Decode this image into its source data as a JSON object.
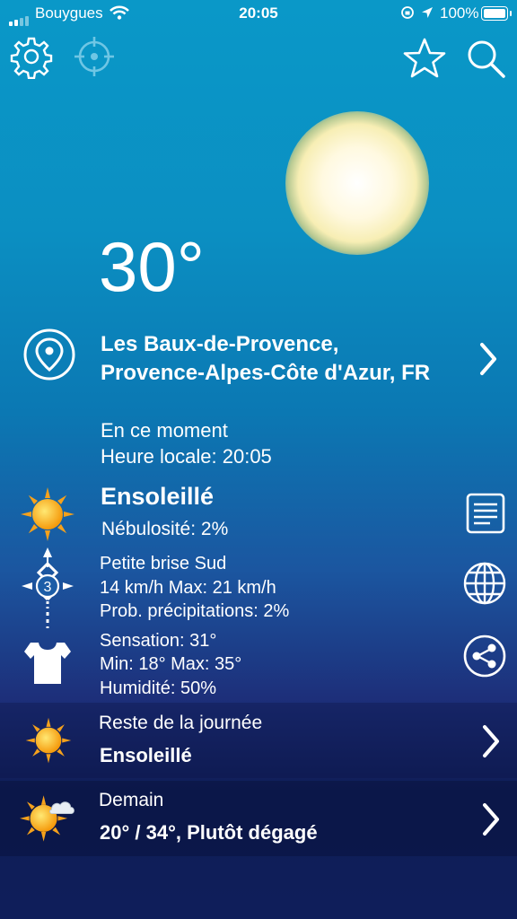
{
  "status": {
    "carrier": "Bouygues",
    "time": "20:05",
    "battery": "100%"
  },
  "toolbar": {
    "settings_icon": "gear-icon",
    "locate_icon": "crosshair-icon",
    "favorite_icon": "star-icon",
    "search_icon": "search-icon"
  },
  "current": {
    "temperature": "30°",
    "location_line1": "Les Baux-de-Provence,",
    "location_line2": "Provence-Alpes-Côte d'Azur, FR",
    "now_label": "En ce moment",
    "local_time": "Heure locale: 20:05",
    "condition": "Ensoleillé",
    "cloud_cover": "Nébulosité: 2%",
    "wind": "Petite brise Sud",
    "wind_speed": "14 km/h Max: 21 km/h",
    "wind_force": "3",
    "precip": "Prob. précipitations: 2%",
    "feels_like": "Sensation: 31°",
    "minmax": "Min: 18°  Max: 35°",
    "humidity": "Humidité: 50%"
  },
  "rest_of_day": {
    "label": "Reste de la journée",
    "value": "Ensoleillé"
  },
  "tomorrow": {
    "label": "Demain",
    "value": "20° / 34°, Plutôt dégagé"
  },
  "colors": {
    "sun_icon": "#f5a623",
    "background_top": "#0a98c8",
    "background_bottom": "#0f1e5a"
  }
}
